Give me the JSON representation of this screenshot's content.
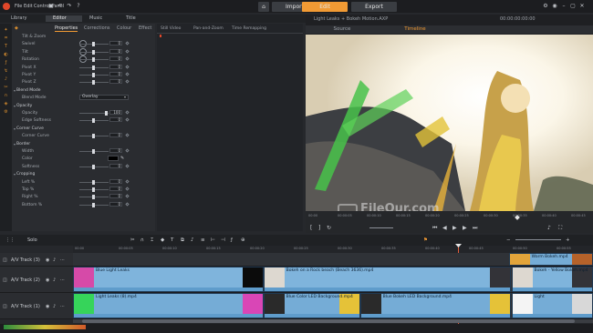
{
  "app": {
    "menu": [
      "File",
      "Edit",
      "Control Panel"
    ],
    "modes": [
      {
        "label": "Import",
        "active": false
      },
      {
        "label": "Edit",
        "active": true
      },
      {
        "label": "Export",
        "active": false
      }
    ],
    "project_title": "Light Leaks + Bokeh Motion.AXP",
    "timecode": "00:00:00:00:00",
    "accent": "#f19a34"
  },
  "library_tabs": [
    "Library",
    "Editor",
    "Music",
    "Title"
  ],
  "editor": {
    "tabs": [
      "Properties",
      "Corrections",
      "Colour",
      "Effect"
    ],
    "timeline_tabs": [
      "Still Video",
      "Pan-and-Zoom",
      "Time Remapping"
    ],
    "rows": [
      {
        "type": "label",
        "text": "Tilt & Zoom"
      },
      {
        "type": "param",
        "text": "Swivel",
        "value": "0"
      },
      {
        "type": "param",
        "text": "Tilt",
        "value": "0"
      },
      {
        "type": "param",
        "text": "Rotation",
        "value": "0"
      },
      {
        "type": "param",
        "text": "Pivot X",
        "value": "0"
      },
      {
        "type": "param",
        "text": "Pivot Y",
        "value": "0"
      },
      {
        "type": "param",
        "text": "Pivot Z",
        "value": "0"
      },
      {
        "type": "section",
        "text": "Blend Mode"
      },
      {
        "type": "select",
        "text": "Blend Mode",
        "value": "Overlay"
      },
      {
        "type": "section",
        "text": "Opacity"
      },
      {
        "type": "param",
        "text": "Opacity",
        "value": "100"
      },
      {
        "type": "param",
        "text": "Edge Softness",
        "value": "0"
      },
      {
        "type": "section",
        "text": "Corner Curve"
      },
      {
        "type": "param",
        "text": "Corner Curve",
        "value": "0"
      },
      {
        "type": "section",
        "text": "Border"
      },
      {
        "type": "param",
        "text": "Width",
        "value": "0"
      },
      {
        "type": "color",
        "text": "Color",
        "value": ""
      },
      {
        "type": "param",
        "text": "Softness",
        "value": "0"
      },
      {
        "type": "section",
        "text": "Cropping"
      },
      {
        "type": "param",
        "text": "Left %",
        "value": "0"
      },
      {
        "type": "param",
        "text": "Top %",
        "value": "0"
      },
      {
        "type": "param",
        "text": "Right %",
        "value": "0"
      },
      {
        "type": "param",
        "text": "Bottom %",
        "value": "0"
      }
    ]
  },
  "preview": {
    "tabs": [
      {
        "label": "Source",
        "active": false
      },
      {
        "label": "Timeline",
        "active": true
      }
    ],
    "ruler_ticks": [
      "00:00",
      "00:00:05",
      "00:00:10",
      "00:00:15",
      "00:00:20",
      "00:00:25",
      "00:00:30",
      "00:00:35",
      "00:00:40",
      "00:00:45"
    ],
    "watermark": "FileOur.com"
  },
  "timeline": {
    "solo_label": "Solo",
    "ruler_ticks": [
      "00:00",
      "00:00:05",
      "00:00:10",
      "00:00:15",
      "00:00:20",
      "00:00:25",
      "00:00:30",
      "00:00:35",
      "00:00:40",
      "00:00:45",
      "00:00:50",
      "00:00:55"
    ],
    "tracks": [
      {
        "name": "A/V Track (3)",
        "clips": [
          {
            "label": "Warm Bokeh.mp4",
            "start": 0.838,
            "end": 1.0,
            "thumbs": "warm"
          }
        ]
      },
      {
        "name": "A/V Track (2)",
        "clips": [
          {
            "label": "Blue Light Leaks",
            "start": 0.0,
            "end": 0.366,
            "thumbs": "pink"
          },
          {
            "label": "Bokeh on a Rock beach (Beach 3636).mp4",
            "start": 0.366,
            "end": 0.843,
            "thumbs": "beach"
          },
          {
            "label": "Bokeh - Yellow Bokeh.mp4",
            "start": 0.843,
            "end": 1.0,
            "thumbs": "beach"
          }
        ]
      },
      {
        "name": "A/V Track (1)",
        "clips": [
          {
            "label": "Light Leaks (8).mp4",
            "start": 0.0,
            "end": 0.366,
            "thumbs": "green"
          },
          {
            "label": "Blue Color LED Background.mp4",
            "start": 0.366,
            "end": 0.552,
            "thumbs": "led"
          },
          {
            "label": "Blue Bokeh LED Background.mp4",
            "start": 0.552,
            "end": 0.843,
            "thumbs": "led"
          },
          {
            "label": "Light",
            "start": 0.843,
            "end": 1.0,
            "thumbs": "white"
          }
        ]
      }
    ],
    "playhead": 0.744
  }
}
